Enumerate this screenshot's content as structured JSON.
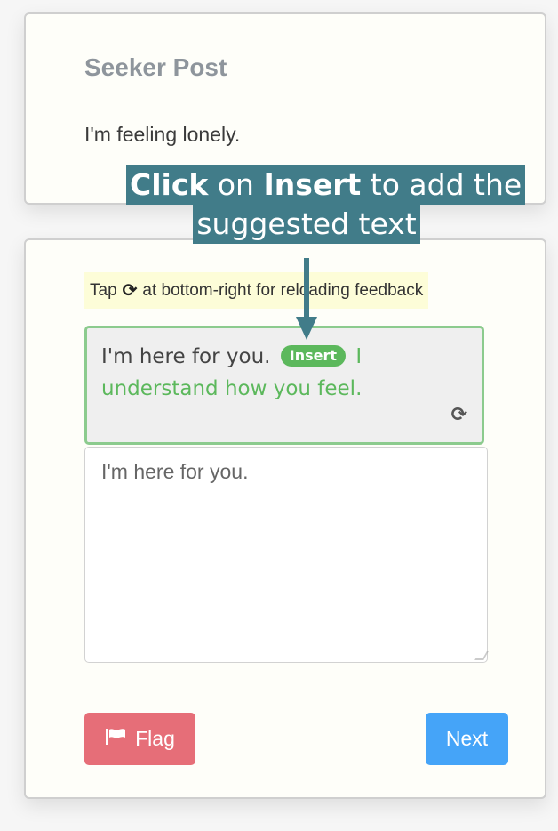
{
  "seeker": {
    "title": "Seeker Post",
    "text": "I'm feeling lonely."
  },
  "tooltip": {
    "line1_bold1": "Click",
    "line1_mid": " on ",
    "line1_bold2": "Insert",
    "line1_end": " to add the",
    "line2": "suggested text"
  },
  "hint": {
    "prefix": "Tap",
    "icon": "reload-icon",
    "suffix": "at bottom-right for reloading feedback"
  },
  "suggestion": {
    "existing_text": "I'm here for you.",
    "insert_label": "Insert",
    "suggested_text": "I understand how you feel.",
    "reload_icon": "reload-icon"
  },
  "response": {
    "value": "I'm here for you."
  },
  "buttons": {
    "flag_label": "Flag",
    "flag_icon": "flag-icon",
    "next_label": "Next"
  },
  "colors": {
    "tooltip_bg": "#417c89",
    "insert_green": "#5cb85c",
    "flag_red": "#e66e78",
    "next_blue": "#45a4f8",
    "hint_bg": "#fdfdd8"
  }
}
